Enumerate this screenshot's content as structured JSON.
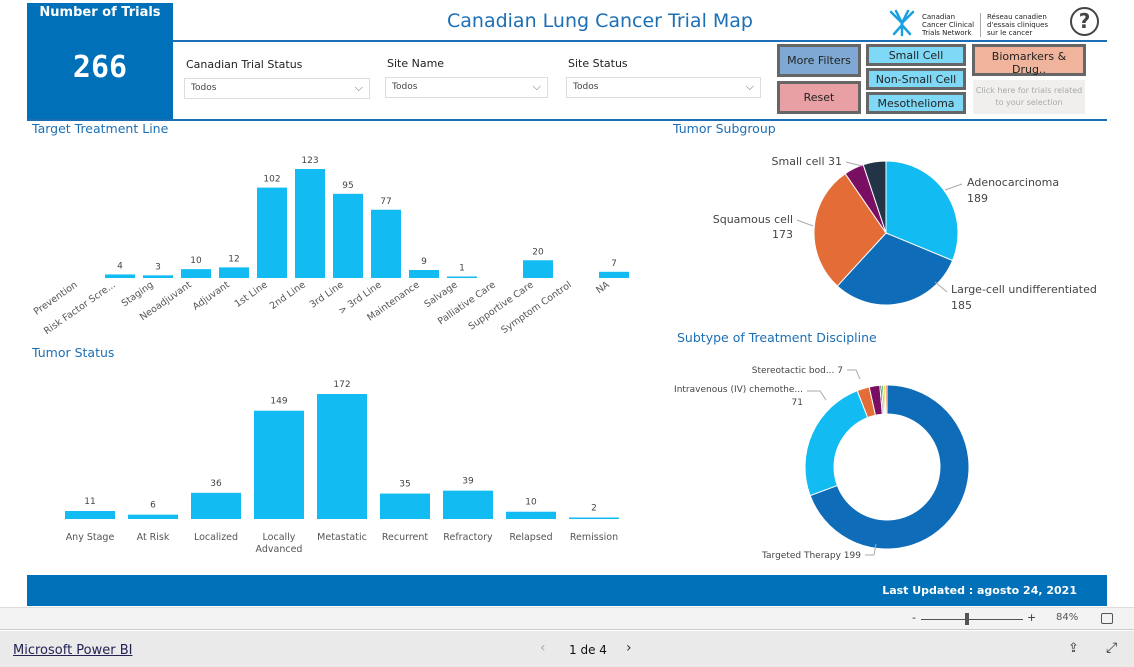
{
  "header": {
    "title": "Canadian Lung Cancer Trial Map",
    "logo_en": "Canadian Cancer Clinical Trials Network",
    "logo_fr": "Réseau canadien d'essais cliniques sur le cancer",
    "help_icon": "question-circle-icon"
  },
  "kpi": {
    "label": "Number of Trials",
    "value": "266"
  },
  "filters": [
    {
      "label": "Canadian Trial Status",
      "value": "Todos"
    },
    {
      "label": "Site Name",
      "value": "Todos"
    },
    {
      "label": "Site Status",
      "value": "Todos"
    }
  ],
  "buttons": {
    "more_filters": "More Filters",
    "reset": "Reset",
    "small_cell": "Small Cell",
    "non_small_cell": "Non-Small Cell",
    "mesothelioma": "Mesothelioma",
    "biomarkers": "Biomarkers & Drug..",
    "biomarkers_hint": "Click here for trials related to your selection"
  },
  "colors": {
    "brand": "#0070b8",
    "bar": "#12bcf2",
    "more_filters": "#7fa9d4",
    "reset": "#e8a0a4",
    "subtype": "#7fd8f5",
    "biomarkers": "#f0b49c"
  },
  "chart_data": [
    {
      "type": "bar",
      "title": "Target Treatment Line",
      "categories": [
        "Prevention",
        "Risk Factor Scre...",
        "Staging",
        "Neoadjuvant",
        "Adjuvant",
        "1st Line",
        "2nd Line",
        "3rd Line",
        "> 3rd Line",
        "Maintenance",
        "Salvage",
        "Palliative Care",
        "Supportive Care",
        "Symptom Control",
        "NA"
      ],
      "values": [
        null,
        4,
        3,
        10,
        12,
        102,
        123,
        95,
        77,
        9,
        1,
        null,
        20,
        null,
        7
      ]
    },
    {
      "type": "bar",
      "title": "Tumor Status",
      "categories": [
        "Any Stage",
        "At Risk",
        "Localized",
        "Locally Advanced",
        "Metastatic",
        "Recurrent",
        "Refractory",
        "Relapsed",
        "Remission"
      ],
      "values": [
        11,
        6,
        36,
        149,
        172,
        35,
        39,
        10,
        2
      ]
    },
    {
      "type": "pie",
      "title": "Tumor Subgroup",
      "slices": [
        {
          "label": "Adenocarcinoma",
          "value": 189,
          "color": "#12bcf2"
        },
        {
          "label": "Large-cell undifferentiated",
          "value": 185,
          "color": "#0e6cb8"
        },
        {
          "label": "Squamous cell",
          "value": 173,
          "color": "#e46c36"
        },
        {
          "label": "",
          "value": 27,
          "color": "#7a0e63"
        },
        {
          "label": "Small cell",
          "value": 31,
          "color": "#243447"
        }
      ]
    },
    {
      "type": "donut",
      "title": "Subtype of Treatment Discipline",
      "slices": [
        {
          "label": "Targeted Therapy",
          "value": 199,
          "color": "#0e6cb8"
        },
        {
          "label": "Intravenous (IV) chemothe...",
          "value": 71,
          "color": "#12bcf2"
        },
        {
          "label": "Stereotactic bod...",
          "value": 7,
          "color": "#e46c36"
        },
        {
          "label": "",
          "value": 6,
          "color": "#7a0e63"
        },
        {
          "label": "",
          "value": 1,
          "color": "#243447"
        },
        {
          "label": "",
          "value": 1,
          "color": "#37a84a"
        },
        {
          "label": "",
          "value": 1,
          "color": "#f2c80f"
        },
        {
          "label": "",
          "value": 1,
          "color": "#e46c36"
        }
      ]
    }
  ],
  "footer": {
    "last_updated": "Last Updated : agosto 24, 2021"
  },
  "zoom": {
    "minus": "-",
    "plus": "+",
    "level": "84%",
    "slider_fraction": 0.45
  },
  "bottom": {
    "brand_link": "Microsoft Power BI",
    "page": "1 de 4"
  }
}
